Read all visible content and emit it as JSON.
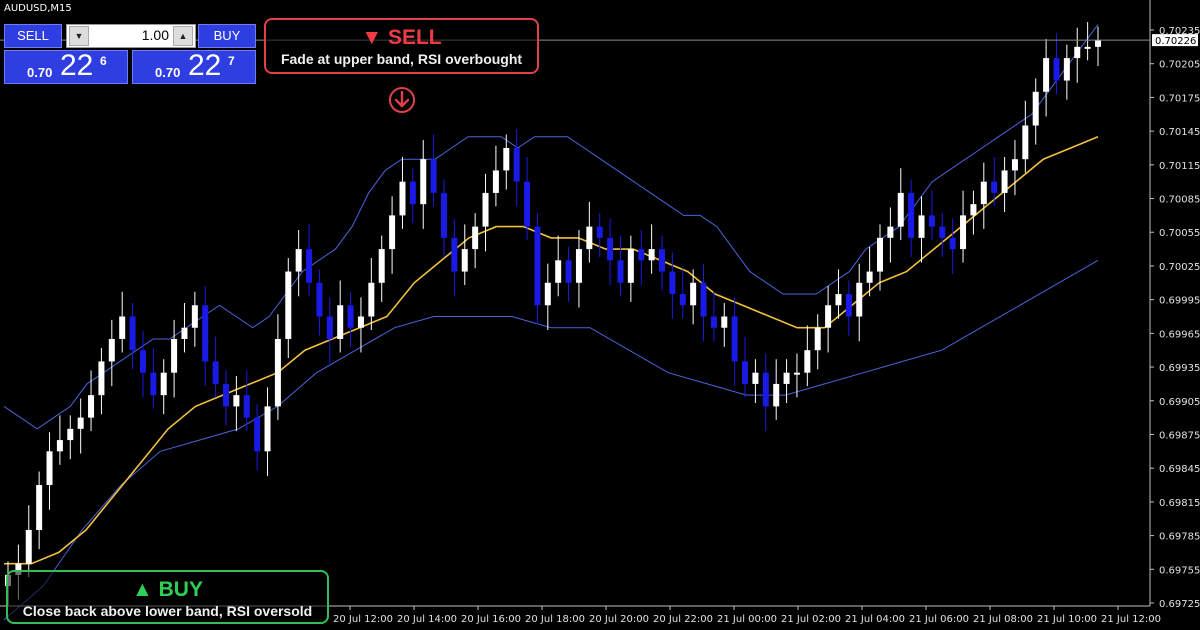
{
  "symbol": "AUDUSD,M15",
  "trade_panel": {
    "sell_label": "SELL",
    "buy_label": "BUY",
    "lot": "1.00",
    "down_icon": "▼",
    "up_icon": "▲",
    "bid_prefix": "0.70",
    "bid_big": "22",
    "bid_sup": "6",
    "ask_prefix": "0.70",
    "ask_big": "22",
    "ask_sup": "7"
  },
  "sell_callout": {
    "title": "▼ SELL",
    "text": "Fade at upper band, RSI overbought",
    "icon": "down-arrow-circle-icon",
    "color": "#e0404a"
  },
  "buy_callout": {
    "title": "▲ BUY",
    "text": "Close back above lower band, RSI oversold",
    "color": "#2fbf55"
  },
  "chart_data": {
    "type": "candlestick",
    "symbol": "AUDUSD",
    "timeframe": "M15",
    "ylim": [
      0.69725,
      0.70235
    ],
    "current_price": 0.70226,
    "y_ticks": [
      "0.70235",
      "0.70205",
      "0.70175",
      "0.70145",
      "0.70115",
      "0.70085",
      "0.70055",
      "0.70025",
      "0.69995",
      "0.69965",
      "0.69935",
      "0.69905",
      "0.69875",
      "0.69845",
      "0.69815",
      "0.69785",
      "0.69755",
      "0.69725"
    ],
    "x_ticks": [
      "20 Jul 12:00",
      "20 Jul 14:00",
      "20 Jul 16:00",
      "20 Jul 18:00",
      "20 Jul 20:00",
      "20 Jul 22:00",
      "21 Jul 00:00",
      "21 Jul 02:00",
      "21 Jul 04:00",
      "21 Jul 06:00",
      "21 Jul 08:00",
      "21 Jul 10:00",
      "21 Jul 12:00"
    ],
    "colors": {
      "up": "#ffffff",
      "down": "#1a1ae6",
      "middle_band": "#f0c040",
      "outer_bands": "#4a64d8",
      "grid_price_line": "#8a8a8a"
    },
    "closes": [
      0.6975,
      0.6976,
      0.6979,
      0.6983,
      0.6986,
      0.6987,
      0.6988,
      0.6989,
      0.6991,
      0.6994,
      0.6996,
      0.6998,
      0.6995,
      0.6993,
      0.6991,
      0.6993,
      0.6996,
      0.6997,
      0.6999,
      0.6994,
      0.6992,
      0.699,
      0.6991,
      0.6989,
      0.6986,
      0.699,
      0.6996,
      0.7002,
      0.7004,
      0.7001,
      0.6998,
      0.6996,
      0.6999,
      0.6997,
      0.6998,
      0.7001,
      0.7004,
      0.7007,
      0.701,
      0.7008,
      0.7012,
      0.7009,
      0.7005,
      0.7002,
      0.7004,
      0.7006,
      0.7009,
      0.7011,
      0.7013,
      0.701,
      0.7006,
      0.6999,
      0.7001,
      0.7003,
      0.7001,
      0.7004,
      0.7006,
      0.7005,
      0.7003,
      0.7001,
      0.7004,
      0.7003,
      0.7004,
      0.7002,
      0.7,
      0.6999,
      0.7001,
      0.6998,
      0.6997,
      0.6998,
      0.6994,
      0.6992,
      0.6993,
      0.699,
      0.6992,
      0.6993,
      0.6993,
      0.6995,
      0.6997,
      0.6999,
      0.7,
      0.6998,
      0.7001,
      0.7002,
      0.7005,
      0.7006,
      0.7009,
      0.7005,
      0.7007,
      0.7006,
      0.7005,
      0.7004,
      0.7007,
      0.7008,
      0.701,
      0.7009,
      0.7011,
      0.7012,
      0.7015,
      0.7018,
      0.7021,
      0.7019,
      0.7021,
      0.7022,
      0.7022,
      0.70226
    ],
    "upper_band": [
      0.699,
      0.6989,
      0.6988,
      0.6989,
      0.699,
      0.6992,
      0.6993,
      0.6994,
      0.6995,
      0.6996,
      0.6996,
      0.6997,
      0.6998,
      0.6999,
      0.6998,
      0.6997,
      0.6998,
      0.7,
      0.7002,
      0.7003,
      0.7004,
      0.7006,
      0.7009,
      0.7011,
      0.7012,
      0.7012,
      0.7012,
      0.7013,
      0.7014,
      0.7014,
      0.7014,
      0.7013,
      0.7014,
      0.7014,
      0.7014,
      0.7013,
      0.7012,
      0.7011,
      0.701,
      0.7009,
      0.7008,
      0.7007,
      0.7007,
      0.7006,
      0.7004,
      0.7002,
      0.7001,
      0.7,
      0.7,
      0.7,
      0.7001,
      0.7002,
      0.7004,
      0.7005,
      0.7006,
      0.7008,
      0.701,
      0.7011,
      0.7012,
      0.7013,
      0.7014,
      0.7015,
      0.7016,
      0.7018,
      0.702,
      0.7022,
      0.7024
    ],
    "middle_band": [
      0.6976,
      0.6976,
      0.6977,
      0.6979,
      0.6982,
      0.6985,
      0.6988,
      0.699,
      0.6991,
      0.6992,
      0.6993,
      0.6995,
      0.6996,
      0.6997,
      0.6998,
      0.7001,
      0.7003,
      0.7005,
      0.7006,
      0.7006,
      0.7005,
      0.7005,
      0.7004,
      0.7004,
      0.7003,
      0.7002,
      0.7,
      0.6999,
      0.6998,
      0.6997,
      0.6997,
      0.6999,
      0.7001,
      0.7002,
      0.7004,
      0.7006,
      0.7008,
      0.701,
      0.7012,
      0.7013,
      0.7014
    ],
    "lower_band": [
      0.6971,
      0.6974,
      0.6979,
      0.6983,
      0.6986,
      0.6987,
      0.6988,
      0.699,
      0.6993,
      0.6995,
      0.6997,
      0.6998,
      0.6998,
      0.6998,
      0.6997,
      0.6997,
      0.6995,
      0.6993,
      0.6992,
      0.6991,
      0.6991,
      0.6992,
      0.6993,
      0.6994,
      0.6995,
      0.6997,
      0.6999,
      0.7001,
      0.7003
    ]
  }
}
